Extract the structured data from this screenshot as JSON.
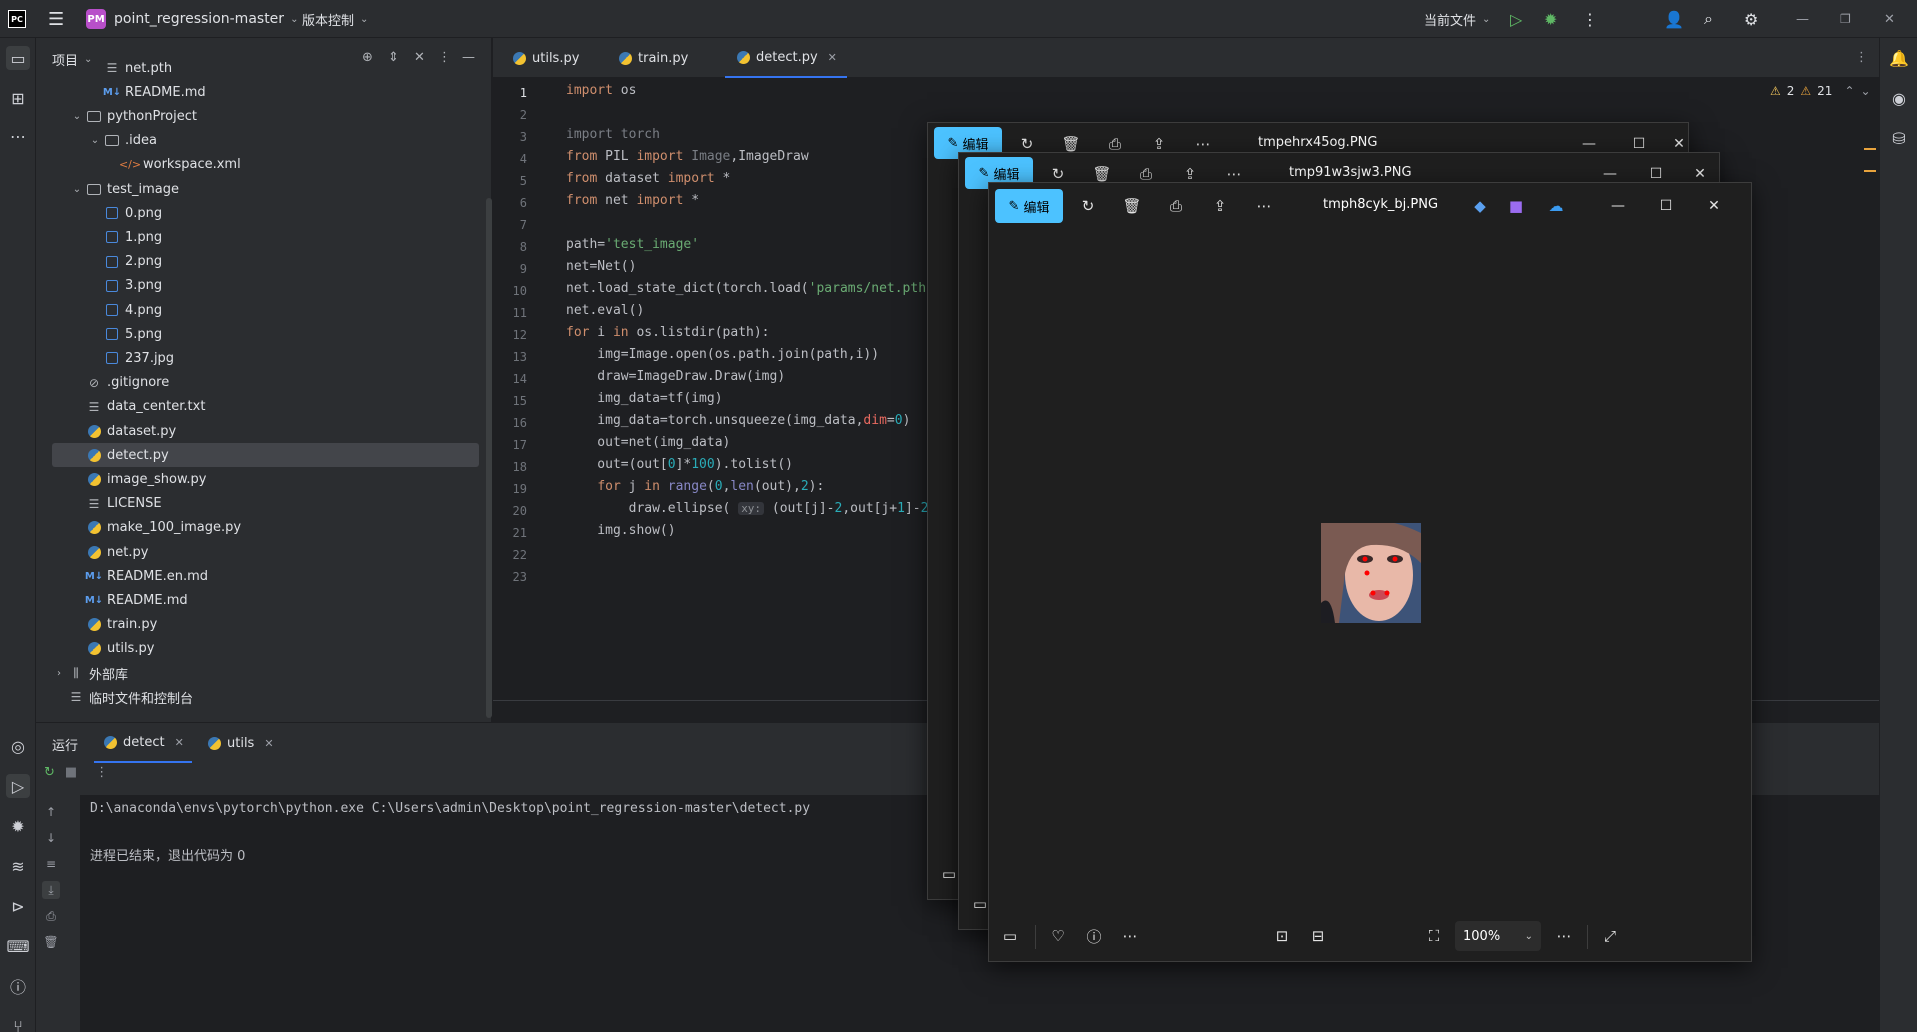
{
  "titlebar": {
    "project_badge": "PM",
    "project_name": "point_regression-master",
    "vcs_label": "版本控制",
    "current_file_label": "当前文件"
  },
  "project_panel": {
    "header": "项目",
    "items": [
      {
        "label": "net.pth",
        "type": "file"
      },
      {
        "label": "README.md",
        "type": "md"
      },
      {
        "label": "pythonProject",
        "type": "folder"
      },
      {
        "label": ".idea",
        "type": "folder"
      },
      {
        "label": "workspace.xml",
        "type": "xml"
      },
      {
        "label": "test_image",
        "type": "folder"
      },
      {
        "label": "0.png",
        "type": "png"
      },
      {
        "label": "1.png",
        "type": "png"
      },
      {
        "label": "2.png",
        "type": "png"
      },
      {
        "label": "3.png",
        "type": "png"
      },
      {
        "label": "4.png",
        "type": "png"
      },
      {
        "label": "5.png",
        "type": "png"
      },
      {
        "label": "237.jpg",
        "type": "png"
      },
      {
        "label": ".gitignore",
        "type": "ignore"
      },
      {
        "label": "data_center.txt",
        "type": "txt"
      },
      {
        "label": "dataset.py",
        "type": "py"
      },
      {
        "label": "detect.py",
        "type": "py"
      },
      {
        "label": "image_show.py",
        "type": "py"
      },
      {
        "label": "LICENSE",
        "type": "txt"
      },
      {
        "label": "make_100_image.py",
        "type": "py"
      },
      {
        "label": "net.py",
        "type": "py"
      },
      {
        "label": "README.en.md",
        "type": "md"
      },
      {
        "label": "README.md",
        "type": "md"
      },
      {
        "label": "train.py",
        "type": "py"
      },
      {
        "label": "utils.py",
        "type": "py"
      },
      {
        "label": "外部库",
        "type": "lib"
      },
      {
        "label": "临时文件和控制台",
        "type": "scratch"
      }
    ]
  },
  "editor": {
    "tabs": [
      "utils.py",
      "train.py",
      "detect.py"
    ],
    "active_tab": "detect.py",
    "warnings_a": "2",
    "warnings_b": "21",
    "line_numbers": [
      "1",
      "2",
      "3",
      "4",
      "5",
      "6",
      "7",
      "8",
      "9",
      "10",
      "11",
      "12",
      "13",
      "14",
      "15",
      "16",
      "17",
      "18",
      "19",
      "20",
      "21",
      "22",
      "23"
    ]
  },
  "run_panel": {
    "label": "运行",
    "tabs": [
      "detect",
      "utils"
    ],
    "command": "D:\\anaconda\\envs\\pytorch\\python.exe C:\\Users\\admin\\Desktop\\point_regression-master\\detect.py",
    "exit_message": "进程已结束，退出代码为 0"
  },
  "viewers": [
    {
      "title": "tmpehrx45og.PNG",
      "edit_label": "编辑"
    },
    {
      "title": "tmp91w3sjw3.PNG",
      "edit_label": "编辑"
    },
    {
      "title": "tmph8cyk_bj.PNG",
      "edit_label": "编辑",
      "zoom": "100%"
    }
  ],
  "colors": {
    "accent": "#3574f0",
    "viewer_edit": "#4cc2ff",
    "python_keyword": "#cf8e6d",
    "python_string": "#6aab73",
    "python_number": "#2aacb8"
  }
}
